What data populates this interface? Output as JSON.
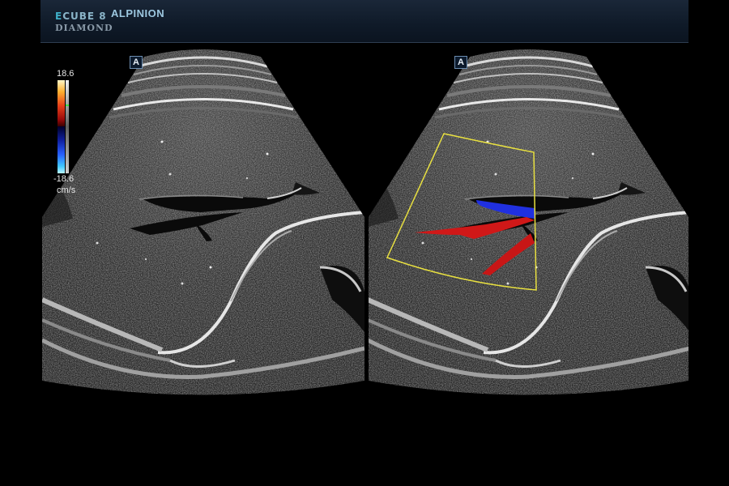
{
  "header": {
    "logo_line1_e": "E",
    "logo_line1_rest": "CUBE 8",
    "logo_line2": "DIAMOND",
    "brand": "ALPINION"
  },
  "left_pane": {
    "mode": "B-mode",
    "probe_marker": "A"
  },
  "right_pane": {
    "mode": "Color Doppler",
    "probe_marker": "A"
  },
  "color_scale": {
    "max": "18.6",
    "min": "-18.6",
    "unit": "cm/s"
  },
  "colors": {
    "header_bg": "#0f1a28",
    "brand_text": "#9dc8e0",
    "roi_box": "#e8e040",
    "flow_toward": "#d01818",
    "flow_away": "#2030e0"
  }
}
